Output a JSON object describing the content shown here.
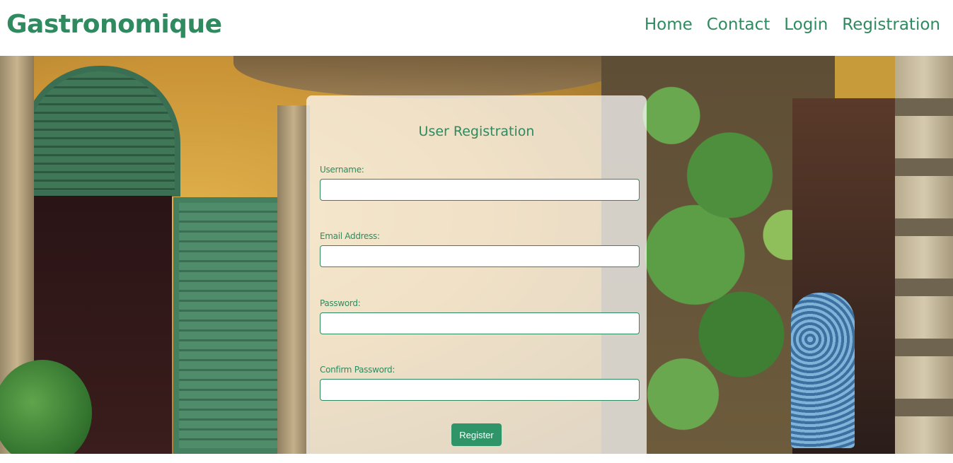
{
  "header": {
    "brand": "Gastronomique",
    "nav": [
      "Home",
      "Contact",
      "Login",
      "Registration"
    ]
  },
  "form": {
    "title": "User Registration",
    "fields": [
      {
        "label": "Username:",
        "value": "",
        "placeholder": ""
      },
      {
        "label": "Email Address:",
        "value": "",
        "placeholder": ""
      },
      {
        "label": "Password:",
        "value": "",
        "placeholder": ""
      },
      {
        "label": "Confirm Password:",
        "value": "",
        "placeholder": ""
      }
    ],
    "submit_label": "Register"
  },
  "colors": {
    "accent": "#2f8a5f",
    "button": "#2f9467"
  }
}
